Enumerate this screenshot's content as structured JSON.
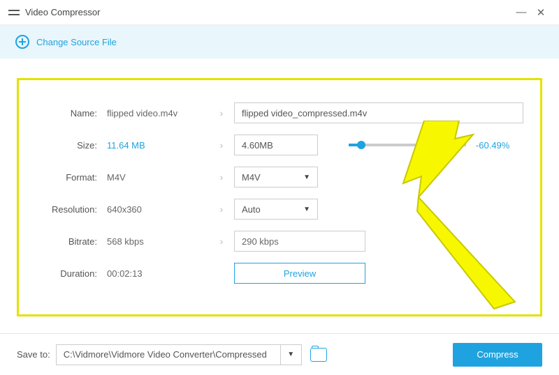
{
  "app": {
    "title": "Video Compressor"
  },
  "toolbar": {
    "change_source": "Change Source File"
  },
  "labels": {
    "name": "Name:",
    "size": "Size:",
    "format": "Format:",
    "resolution": "Resolution:",
    "bitrate": "Bitrate:",
    "duration": "Duration:"
  },
  "original": {
    "name": "flipped video.m4v",
    "size": "11.64 MB",
    "format": "M4V",
    "resolution": "640x360",
    "bitrate": "568 kbps",
    "duration": "00:02:13"
  },
  "output": {
    "name": "flipped video_compressed.m4v",
    "size": "4.60MB",
    "format": "M4V",
    "resolution": "Auto",
    "bitrate": "290 kbps",
    "size_pct": "-60.49%"
  },
  "buttons": {
    "preview": "Preview",
    "compress": "Compress"
  },
  "footer": {
    "save_to_label": "Save to:",
    "path": "C:\\Vidmore\\Vidmore Video Converter\\Compressed"
  }
}
